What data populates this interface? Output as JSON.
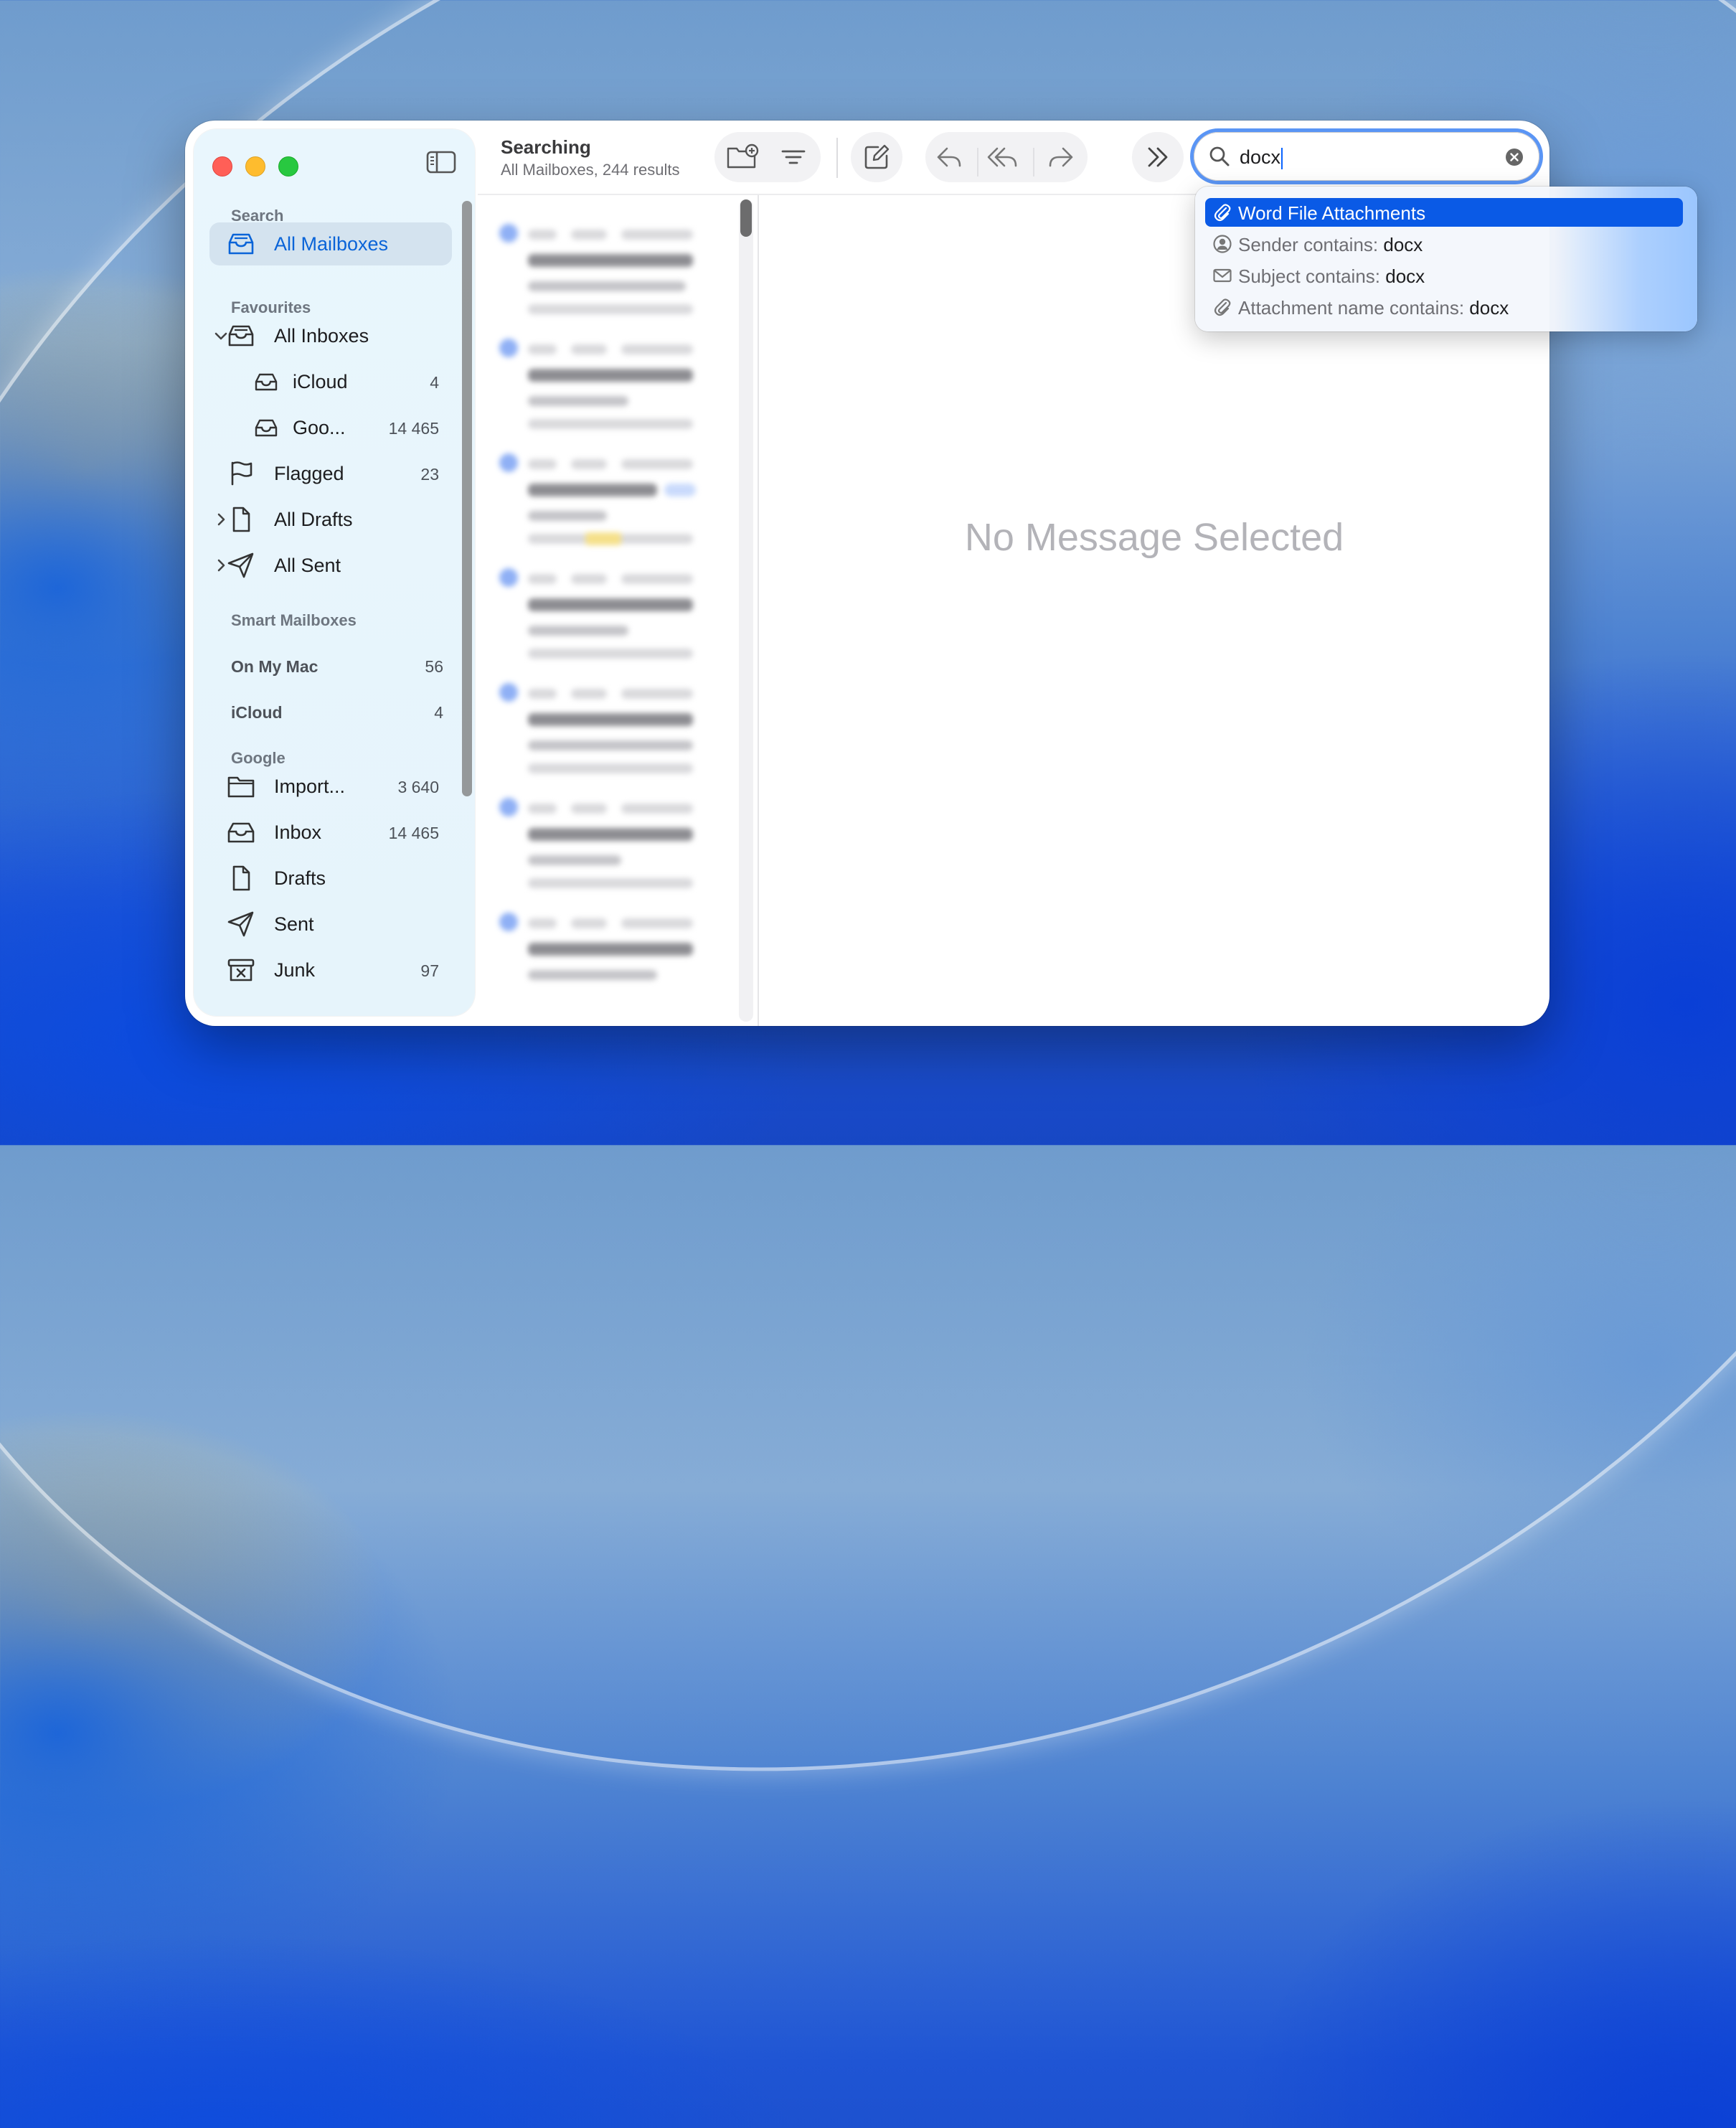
{
  "window": {
    "title": "Searching",
    "subtitle": "All Mailboxes, 244 results",
    "empty_state": "No Message Selected"
  },
  "search": {
    "query": "docx"
  },
  "suggestions": [
    {
      "label": "Word File Attachments",
      "value": "",
      "icon": "paperclip-icon",
      "selected": true
    },
    {
      "label": "Sender contains: ",
      "value": "docx",
      "icon": "person-circle-icon",
      "selected": false
    },
    {
      "label": "Subject contains: ",
      "value": "docx",
      "icon": "envelope-icon",
      "selected": false
    },
    {
      "label": "Attachment name contains: ",
      "value": "docx",
      "icon": "paperclip-icon",
      "selected": false
    }
  ],
  "sidebar": {
    "search_header": "Search",
    "all_mailboxes": "All Mailboxes",
    "favourites_header": "Favourites",
    "all_inboxes": "All Inboxes",
    "icloud_label": "iCloud",
    "icloud_count": "4",
    "google_label": "Goo...",
    "google_count": "14 465",
    "flagged_label": "Flagged",
    "flagged_count": "23",
    "all_drafts": "All Drafts",
    "all_sent": "All Sent",
    "smart_header": "Smart Mailboxes",
    "on_my_mac_label": "On My Mac",
    "on_my_mac_count": "56",
    "icloud_account_label": "iCloud",
    "icloud_account_count": "4",
    "google_header": "Google",
    "important_label": "Import...",
    "important_count": "3 640",
    "inbox_label": "Inbox",
    "inbox_count": "14 465",
    "drafts_label": "Drafts",
    "sent_label": "Sent",
    "junk_label": "Junk",
    "junk_count": "97"
  },
  "colors": {
    "accent": "#0a5ae6",
    "selection_text": "#0a64d8",
    "traffic_red": "#ff5f57",
    "traffic_yellow": "#febc2e",
    "traffic_green": "#28c840"
  }
}
